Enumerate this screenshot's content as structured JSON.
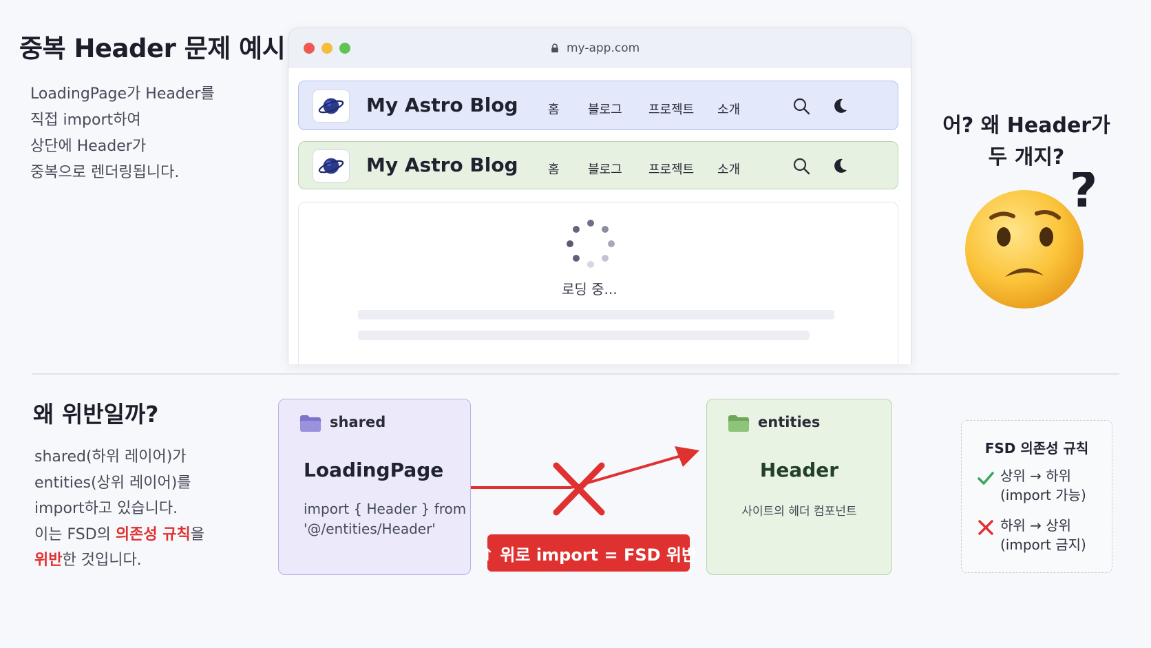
{
  "top_section": {
    "title": "중복 Header 문제 예시",
    "description_lines": [
      "LoadingPage가 Header를",
      "직접 import하여",
      "상단에 Header가",
      "중복으로 렌더링됩니다."
    ]
  },
  "browser": {
    "url": "my-app.com",
    "headers": [
      {
        "brand": "My Astro Blog",
        "nav": [
          "홈",
          "블로그",
          "프로젝트",
          "소개"
        ],
        "color": "#e3e8fb"
      },
      {
        "brand": "My Astro Blog",
        "nav": [
          "홈",
          "블로그",
          "프로젝트",
          "소개"
        ],
        "color": "#e6f1e2"
      }
    ],
    "loading_text": "로딩 중..."
  },
  "question": {
    "lines": [
      "어? 왜 Header가",
      "두 개지?"
    ],
    "mark": "?"
  },
  "bottom_section": {
    "title": "왜 위반일까?",
    "description": {
      "line1": "shared(하위 레이어)가",
      "line2": "entities(상위 레이어)를",
      "line3": "import하고 있습니다.",
      "line4_prefix": "이는 FSD의 ",
      "line4_highlight": "의존성 규칙",
      "line4_suffix": "을",
      "line5_highlight": "위반",
      "line5_suffix": "한 것입니다."
    }
  },
  "shared_box": {
    "layer": "shared",
    "component": "LoadingPage",
    "code_lines": [
      "import { Header } from",
      "'@/entities/Header'"
    ]
  },
  "entities_box": {
    "layer": "entities",
    "component": "Header",
    "description": "사이트의 헤더 컴포넌트"
  },
  "violation_label": "↑ 위로 import = FSD 위반",
  "rules": {
    "title": "FSD 의존성 규칙",
    "allowed": {
      "line1": "상위 → 하위",
      "line2": "(import 가능)"
    },
    "forbidden": {
      "line1": "하위 → 상위",
      "line2": "(import 금지)"
    }
  },
  "colors": {
    "accent_red": "#e03131",
    "shared_bg": "#ece9fb",
    "entities_bg": "#e8f3e4",
    "check_green": "#3aa55b"
  }
}
